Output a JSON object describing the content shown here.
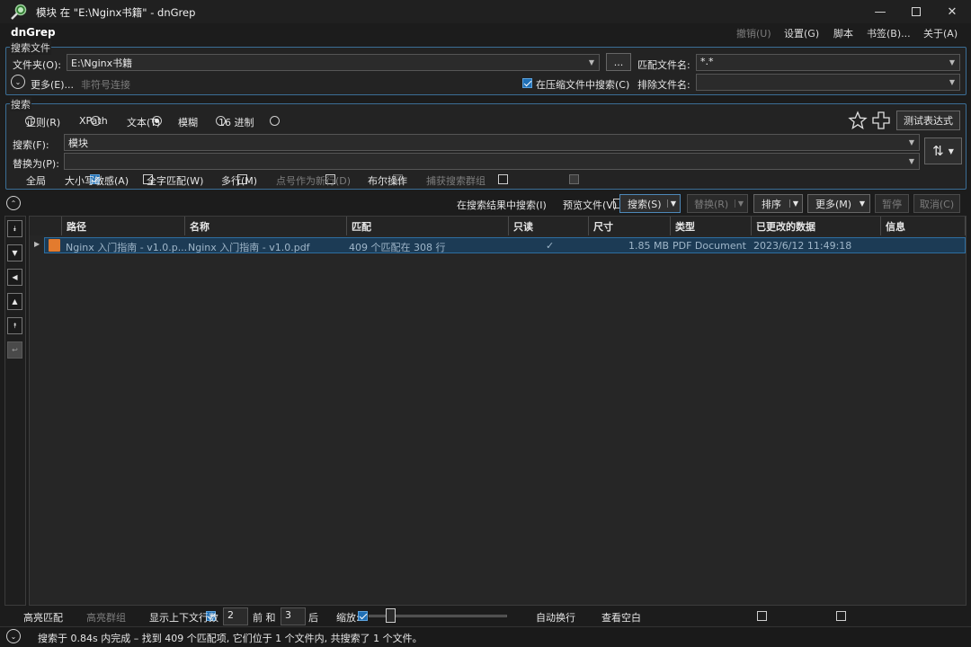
{
  "window": {
    "title": "模块 在 \"E:\\Nginx书籍\" - dnGrep",
    "app_name": "dnGrep"
  },
  "menu": {
    "undo": "撤销(U)",
    "settings": "设置(G)",
    "script": "脚本",
    "bookmarks": "书签(B)...",
    "about": "关于(A)"
  },
  "search_files": {
    "group_label": "搜索文件",
    "folder_label": "文件夹(O):",
    "folder_value": "E:\\Nginx书籍",
    "browse_label": "...",
    "match_label": "匹配文件名:",
    "match_value": "*.*",
    "more_label": "更多(E)...",
    "non_symbol": "非符号连接",
    "archive_label": "在压缩文件中搜索(C)",
    "exclude_label": "排除文件名:",
    "exclude_value": ""
  },
  "search": {
    "group_label": "搜索",
    "modes": [
      "正则(R)",
      "XPath",
      "文本(T)",
      "模糊",
      "16 进制"
    ],
    "selected_mode": "文本(T)",
    "test_expr": "测试表达式",
    "search_label": "搜索(F):",
    "search_value": "模块",
    "replace_label": "替换为(P):",
    "replace_value": "",
    "options": [
      {
        "label": "全局",
        "checked": true,
        "enabled": true
      },
      {
        "label": "大小写敏感(A)",
        "checked": false,
        "enabled": true
      },
      {
        "label": "全字匹配(W)",
        "checked": false,
        "enabled": true
      },
      {
        "label": "多行(M)",
        "checked": false,
        "enabled": true
      },
      {
        "label": "点号作为新行(D)",
        "checked": false,
        "enabled": false
      },
      {
        "label": "布尔操作",
        "checked": false,
        "enabled": true
      },
      {
        "label": "捕获搜索群组",
        "checked": false,
        "enabled": false
      }
    ]
  },
  "toolbar": {
    "search_in_results": "在搜索结果中搜索(I)",
    "preview_file": "预览文件(V)",
    "search_btn": "搜索(S)",
    "replace_btn": "替换(R)",
    "sort_btn": "排序",
    "more_btn": "更多(M)",
    "pause_btn": "暂停",
    "cancel_btn": "取消(C)"
  },
  "grid": {
    "columns": [
      "路径",
      "名称",
      "匹配",
      "只读",
      "尺寸",
      "类型",
      "已更改的数据",
      "信息"
    ],
    "rows": [
      {
        "path": "Nginx 入门指南 - v1.0.p...",
        "name": "Nginx 入门指南 - v1.0.pdf",
        "matches": "409 个匹配在 308 行",
        "readonly": "✓",
        "size": "1.85 MB",
        "type": "PDF Document",
        "modified": "2023/6/12 11:49:18",
        "info": ""
      }
    ]
  },
  "bottom": {
    "highlight_matches": "高亮匹配",
    "highlight_groups": "高亮群组",
    "show_context": "显示上下文行数",
    "before_value": "2",
    "before_label": "前 和",
    "after_value": "3",
    "after_label": "后",
    "zoom_label": "缩放:",
    "zoom_level": 0.06,
    "word_wrap": "自动换行",
    "view_whitespace": "查看空白"
  },
  "status": {
    "text": "搜索于 0.84s 内完成 – 找到 409 个匹配项, 它们位于 1 个文件内, 共搜索了 1 个文件。"
  },
  "colors": {
    "accent": "#3b6e96",
    "selected_row": "#1c3b55",
    "checkbox_on": "#1f6fb5"
  }
}
